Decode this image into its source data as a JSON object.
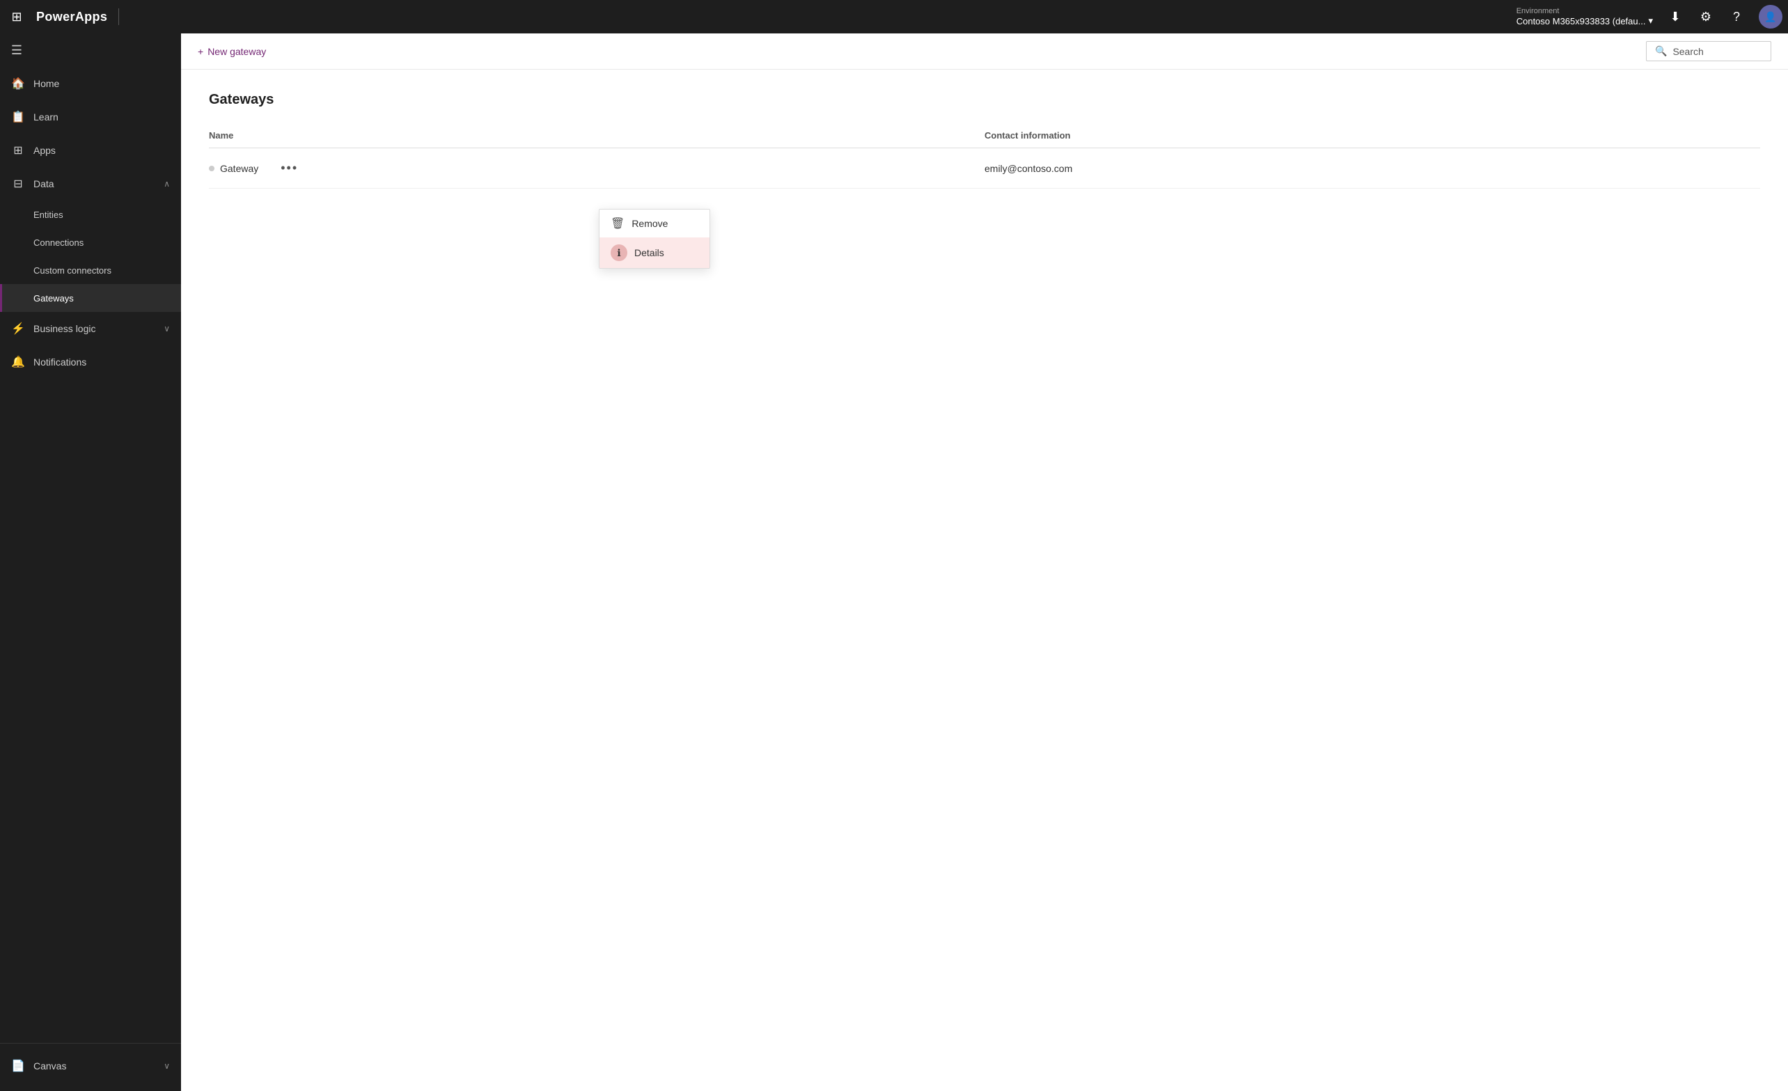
{
  "app": {
    "brand": "PowerApps",
    "waffle_icon": "⊞"
  },
  "topbar": {
    "env_label": "Environment",
    "env_name": "Contoso M365x933833 (defau...",
    "download_icon": "⬇",
    "settings_icon": "⚙",
    "help_icon": "?",
    "avatar_initials": "👤",
    "search_placeholder": "Search"
  },
  "sidebar": {
    "toggle_icon": "☰",
    "items": [
      {
        "id": "home",
        "label": "Home",
        "icon": "🏠"
      },
      {
        "id": "learn",
        "label": "Learn",
        "icon": "📋"
      },
      {
        "id": "apps",
        "label": "Apps",
        "icon": "📱"
      },
      {
        "id": "data",
        "label": "Data",
        "icon": "⊞",
        "expanded": true,
        "chevron": "∧"
      },
      {
        "id": "entities",
        "label": "Entities",
        "sub": true
      },
      {
        "id": "connections",
        "label": "Connections",
        "sub": true
      },
      {
        "id": "custom-connectors",
        "label": "Custom connectors",
        "sub": true
      },
      {
        "id": "gateways",
        "label": "Gateways",
        "sub": true,
        "active": true
      },
      {
        "id": "business-logic",
        "label": "Business logic",
        "icon": "🔗",
        "chevron": "∨"
      },
      {
        "id": "notifications",
        "label": "Notifications",
        "icon": "🔔"
      }
    ],
    "bottom": {
      "canvas_label": "Canvas",
      "canvas_icon": "📄"
    }
  },
  "toolbar": {
    "new_gateway_label": "+ New gateway",
    "search_label": "Search"
  },
  "page": {
    "title": "Gateways",
    "table": {
      "columns": [
        "Name",
        "Contact information"
      ],
      "rows": [
        {
          "name": "Gateway",
          "contact": "emily@contoso.com"
        }
      ]
    }
  },
  "context_menu": {
    "items": [
      {
        "id": "remove",
        "label": "Remove",
        "icon": "🗑"
      },
      {
        "id": "details",
        "label": "Details",
        "icon": "ℹ",
        "hovered": true
      }
    ]
  }
}
